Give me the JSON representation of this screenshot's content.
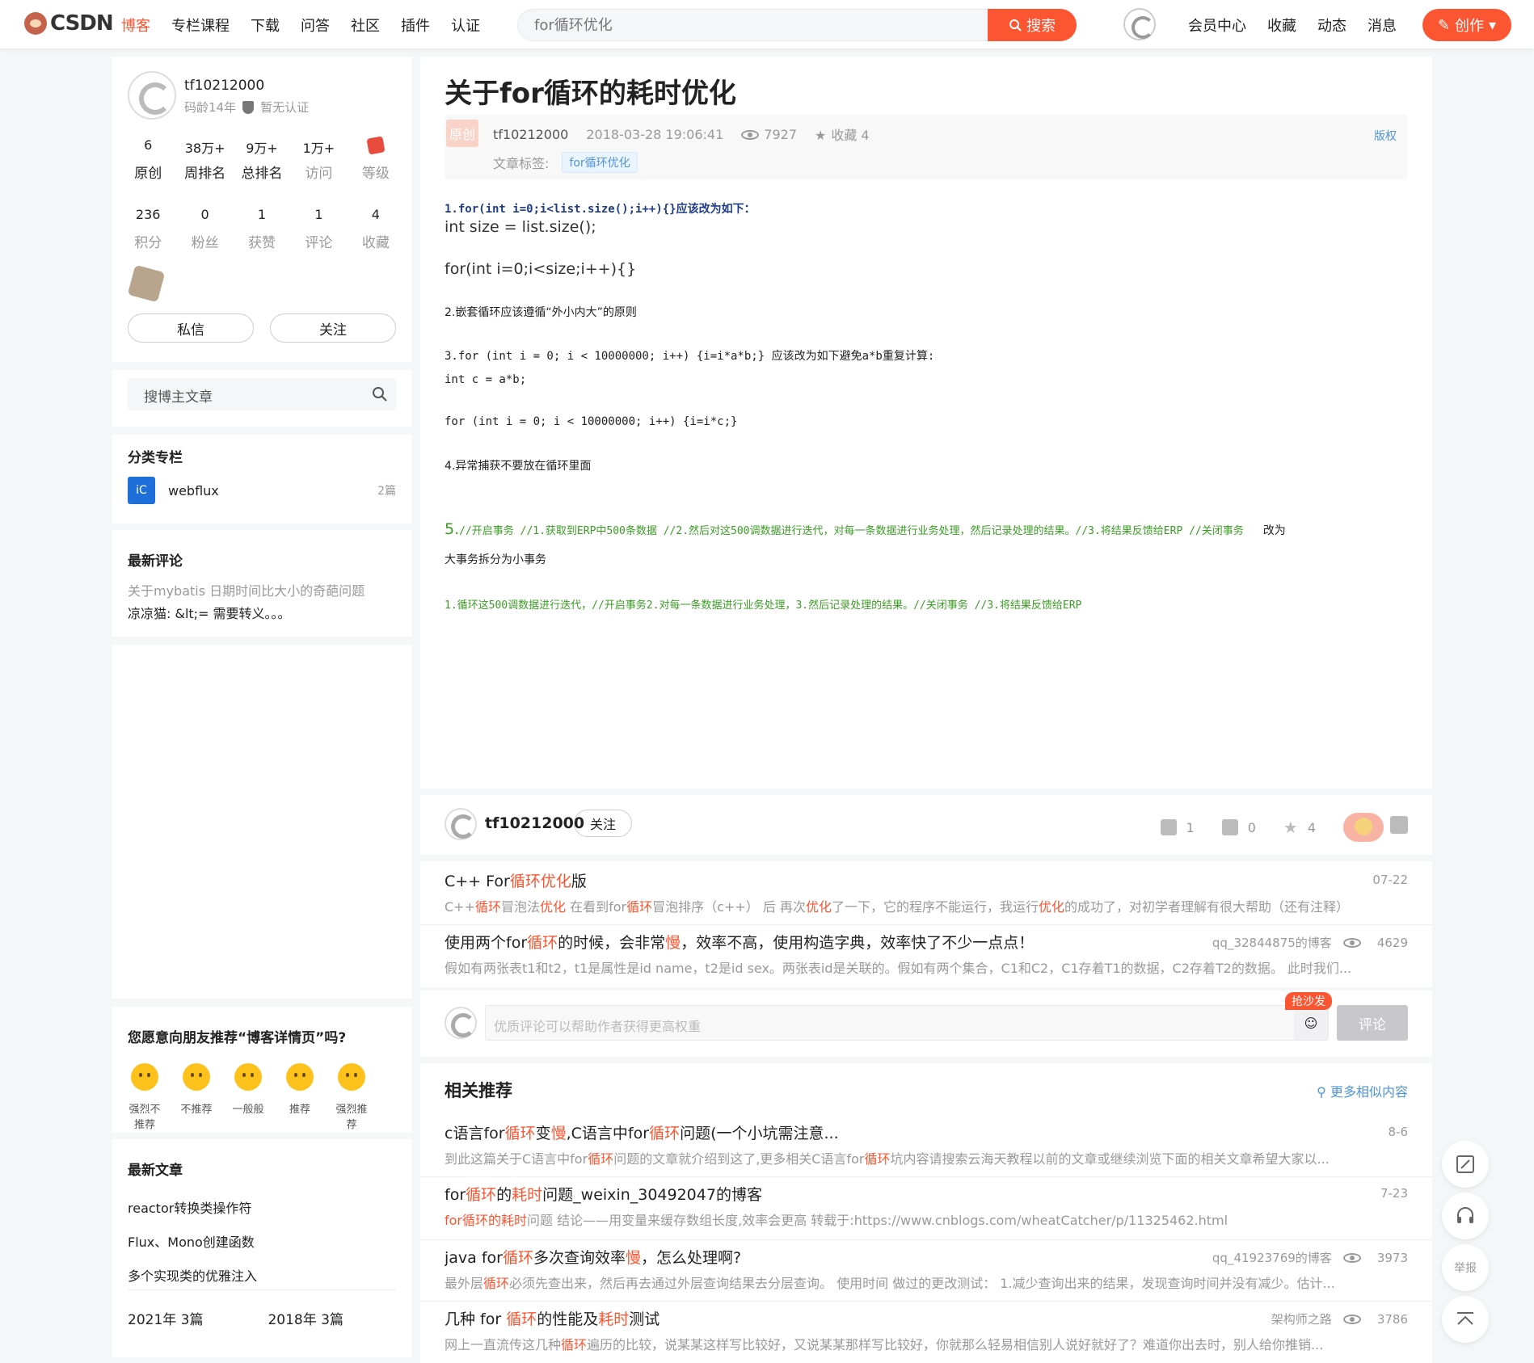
{
  "header": {
    "logo_text": "CSDN",
    "nav": [
      "博客",
      "专栏课程",
      "下载",
      "问答",
      "社区",
      "插件",
      "认证"
    ],
    "search_placeholder": "for循环优化",
    "search_button": "搜索",
    "right_links": [
      "会员中心",
      "收藏",
      "动态",
      "消息"
    ],
    "create_button": "创作"
  },
  "profile": {
    "name": "tf10212000",
    "code_age": "码龄14年",
    "cert": "暂无认证",
    "stats1": [
      {
        "value": "6",
        "label": "原创"
      },
      {
        "value": "38万+",
        "label": "周排名"
      },
      {
        "value": "9万+",
        "label": "总排名"
      },
      {
        "value": "1万+",
        "label": "访问"
      },
      {
        "value": "",
        "label": "等级"
      }
    ],
    "stats2": [
      {
        "value": "236",
        "label": "积分"
      },
      {
        "value": "0",
        "label": "粉丝"
      },
      {
        "value": "1",
        "label": "获赞"
      },
      {
        "value": "1",
        "label": "评论"
      },
      {
        "value": "4",
        "label": "收藏"
      }
    ],
    "message_button": "私信",
    "follow_button": "关注"
  },
  "blog_search": {
    "placeholder": "搜博主文章"
  },
  "category": {
    "title": "分类专栏",
    "items": [
      {
        "name": "webflux",
        "count": "2篇"
      }
    ]
  },
  "comments": {
    "title": "最新评论",
    "items": [
      {
        "title": "关于mybatis 日期时间比大小的奇葩问题",
        "text": "凉凉猫: &lt;= 需要转义。。。"
      }
    ]
  },
  "recommend": {
    "title": "您愿意向朋友推荐“博客详情页”吗?",
    "options": [
      "强烈不推荐",
      "不推荐",
      "一般般",
      "推荐",
      "强烈推荐"
    ]
  },
  "latest": {
    "title": "最新文章",
    "items": [
      "reactor转换类操作符",
      "Flux、Mono创建函数",
      "多个实现类的优雅注入"
    ],
    "archive": [
      "2021年  3篇",
      "2018年  3篇"
    ]
  },
  "article": {
    "title": "关于for循环的耗时优化",
    "original_tag": "原创",
    "author": "tf10212000",
    "date": "2018-03-28 19:06:41",
    "views": "7927",
    "favorites": "收藏 4",
    "copyright": "版权",
    "tags_label": "文章标签:",
    "tags": [
      "for循环优化"
    ],
    "lines": {
      "l1": "1.for(int i=0;i<list.size();i++){}应该改为如下：",
      "l2": "int size = list.size();",
      "l3": "for(int i=0;i<size;i++){}",
      "l4": "2.嵌套循环应该遵循“外小内大”的原则",
      "l5": "3.for (int i = 0; i < 10000000; i++) {i=i*a*b;} 应该改为如下避免a*b重复计算:",
      "l6": "int c = a*b;",
      "l7": "for (int i = 0; i < 10000000; i++) {i=i*c;}",
      "l8": "4.异常捕获不要放在循环里面",
      "l9_prefix": "5.",
      "l9": "//开启事务 //1.获取到ERP中500条数据  //2.然后对这500调数据进行迭代，对每一条数据进行业务处理，然后记录处理的结果。//3.将结果反馈给ERP  //关闭事务",
      "l9_suffix": "改为",
      "l10": "大事务拆分为小事务",
      "l11": "1.循环这500调数据进行迭代，//开启事务2.对每一条数据进行业务处理，3.然后记录处理的结果。//关闭事务 //3.将结果反馈给ERP"
    }
  },
  "author_bar": {
    "name": "tf10212000",
    "follow": "关注",
    "likes": "1",
    "comments": "0",
    "favorites": "4"
  },
  "related_top": [
    {
      "title_parts": [
        "C++ For",
        "循环优化",
        "版"
      ],
      "desc_parts": [
        "C++",
        "循环",
        "冒泡法",
        "优化",
        " 在看到for",
        "循环",
        "冒泡排序（c++） 后 再次",
        "优化",
        "了一下，它的程序不能运行，我运行",
        "优化",
        "的成功了，对初学者理解有很大帮助（还有注释）"
      ],
      "date": "07-22"
    },
    {
      "title_parts": [
        "使用两个for",
        "循环",
        "的时候，会非常",
        "慢",
        "，效率不高，使用构造字典，效率快了不少一点点！"
      ],
      "desc": "假如有两张表t1和t2，t1是属性是id name，t2是id  sex。两张表id是关联的。假如有两个集合，C1和C2，C1存着T1的数据，C2存着T2的数据。 此时我们...",
      "blog": "qq_32844875的博客",
      "views": "4629"
    }
  ],
  "comment_box": {
    "placeholder": "优质评论可以帮助作者获得更高权重",
    "sofa": "抢沙发",
    "button": "评论"
  },
  "related": {
    "title": "相关推荐",
    "more": "更多相似内容",
    "items": [
      {
        "title_parts": [
          "c语言for",
          "循环",
          "变",
          "慢",
          ",C语言中for",
          "循环",
          "问题(一个小坑需注意..."
        ],
        "desc_parts": [
          "到此这篇关于C语言中for",
          "循环",
          "问题的文章就介绍到这了,更多相关C语言for",
          "循环",
          "坑内容请搜索云海天教程以前的文章或继续浏览下面的相关文章希望大家以..."
        ],
        "date": "8-6"
      },
      {
        "title_parts": [
          "for",
          "循环",
          "的",
          "耗时",
          "问题_weixin_30492047的博客"
        ],
        "desc_parts": [
          "for",
          "循环",
          "的",
          "耗时",
          "问题 结论——用变量来缓存数组长度,效率会更高 转载于:https://www.cnblogs.com/wheatCatcher/p/11325462.html"
        ],
        "date": "7-23"
      },
      {
        "title_parts": [
          "java for",
          "循环",
          "多次查询效率",
          "慢",
          "，怎么处理啊?"
        ],
        "desc_parts": [
          "最外层",
          "循环",
          "必须先查出来，然后再去通过外层查询结果去分层查询。 使用时间 做过的更改测试： 1.减少查询出来的结果，发现查询时间并没有减少。估计..."
        ],
        "blog": "qq_41923769的博客",
        "views": "3973"
      },
      {
        "title_parts": [
          "几种 for ",
          "循环",
          "的性能及",
          "耗时",
          "测试"
        ],
        "desc_parts": [
          "网上一直流传这几种",
          "循环",
          "遍历的比较，说某某这样写比较好，又说某某那样写比较好，你就那么轻易相信别人说好就好了？难道你出去时，别人给你推销..."
        ],
        "blog": "架构师之路",
        "views": "3786"
      }
    ]
  },
  "float_buttons": {
    "report": "举报"
  }
}
